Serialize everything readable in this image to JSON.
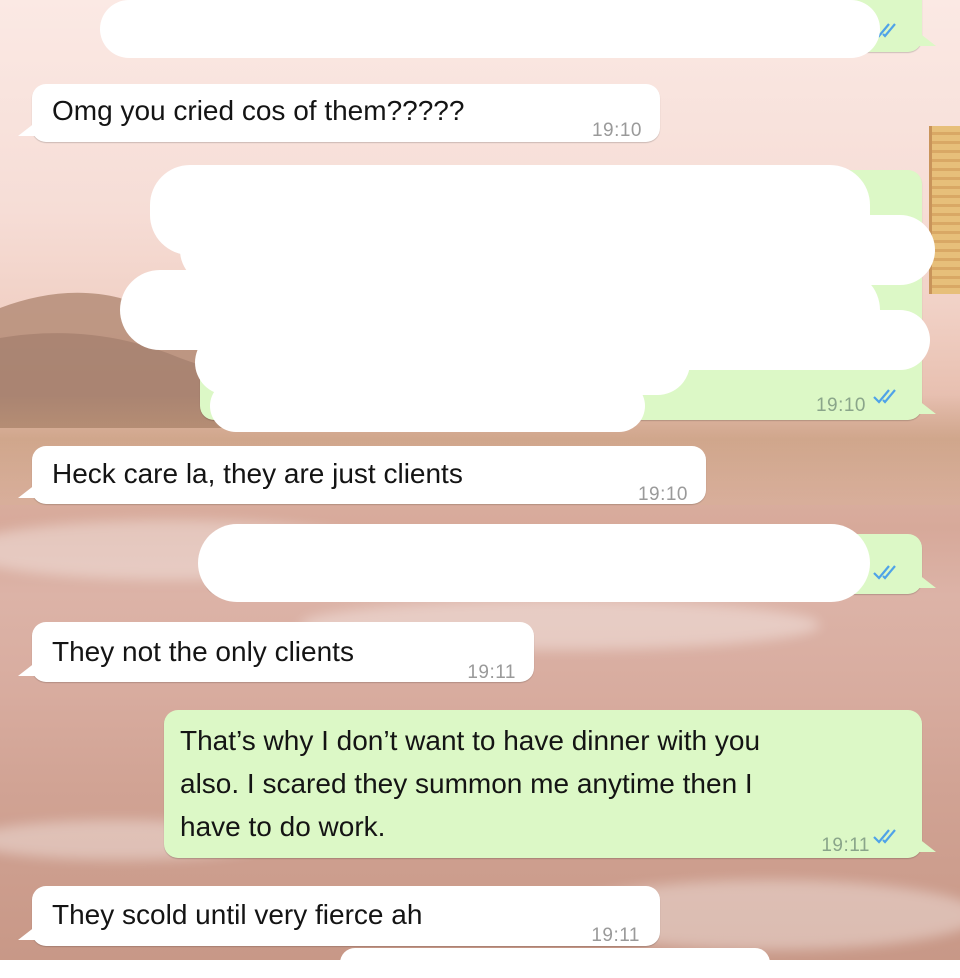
{
  "theme": {
    "incoming_bubble": "#ffffff",
    "outgoing_bubble": "#dcf8c6",
    "tick_color": "#4fa3e8"
  },
  "messages": [
    {
      "direction": "outgoing",
      "text": "",
      "time": "",
      "redacted": true,
      "read_ticks": "double-check-icon"
    },
    {
      "direction": "incoming",
      "text": "Omg you cried cos of them?????",
      "time": "19:10"
    },
    {
      "direction": "outgoing",
      "text": "",
      "time": "19:10",
      "redacted": true,
      "read_ticks": "double-check-icon"
    },
    {
      "direction": "incoming",
      "text": "Heck care la, they are just clients",
      "time": "19:10"
    },
    {
      "direction": "outgoing",
      "text": "",
      "time": "",
      "redacted": true,
      "read_ticks": "double-check-icon"
    },
    {
      "direction": "incoming",
      "text": "They not the only clients",
      "time": "19:11"
    },
    {
      "direction": "outgoing",
      "lines": [
        "That’s why I don’t want to have dinner with you",
        "also. I scared they summon me anytime then I",
        "have to do work."
      ],
      "time": "19:11",
      "read_ticks": "double-check-icon"
    },
    {
      "direction": "incoming",
      "text": "They scold until very fierce ah",
      "time": "19:11"
    }
  ]
}
